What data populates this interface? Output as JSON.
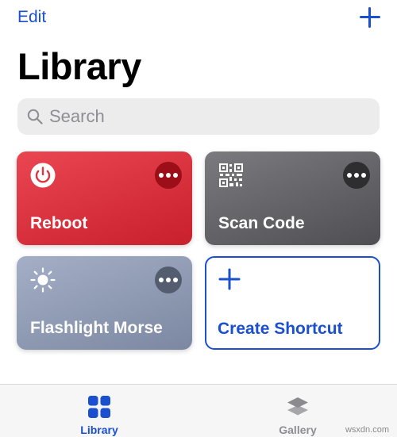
{
  "header": {
    "edit_label": "Edit",
    "title": "Library"
  },
  "search": {
    "placeholder": "Search",
    "value": ""
  },
  "shortcuts": [
    {
      "label": "Reboot",
      "icon": "power-icon",
      "color": "#e03540"
    },
    {
      "label": "Scan Code",
      "icon": "qr-code-icon",
      "color": "#67676b"
    },
    {
      "label": "Flashlight Morse",
      "icon": "sun-icon",
      "color": "#909ab3"
    },
    {
      "label": "Create Shortcut",
      "icon": "plus-icon",
      "color": "#1a4fd0"
    }
  ],
  "tabs": [
    {
      "label": "Library",
      "icon": "grid-icon",
      "active": true
    },
    {
      "label": "Gallery",
      "icon": "layers-icon",
      "active": false
    }
  ],
  "watermark": "wsxdn.com",
  "colors": {
    "accent": "#1a4fd0",
    "inactive": "#8e8e93"
  }
}
